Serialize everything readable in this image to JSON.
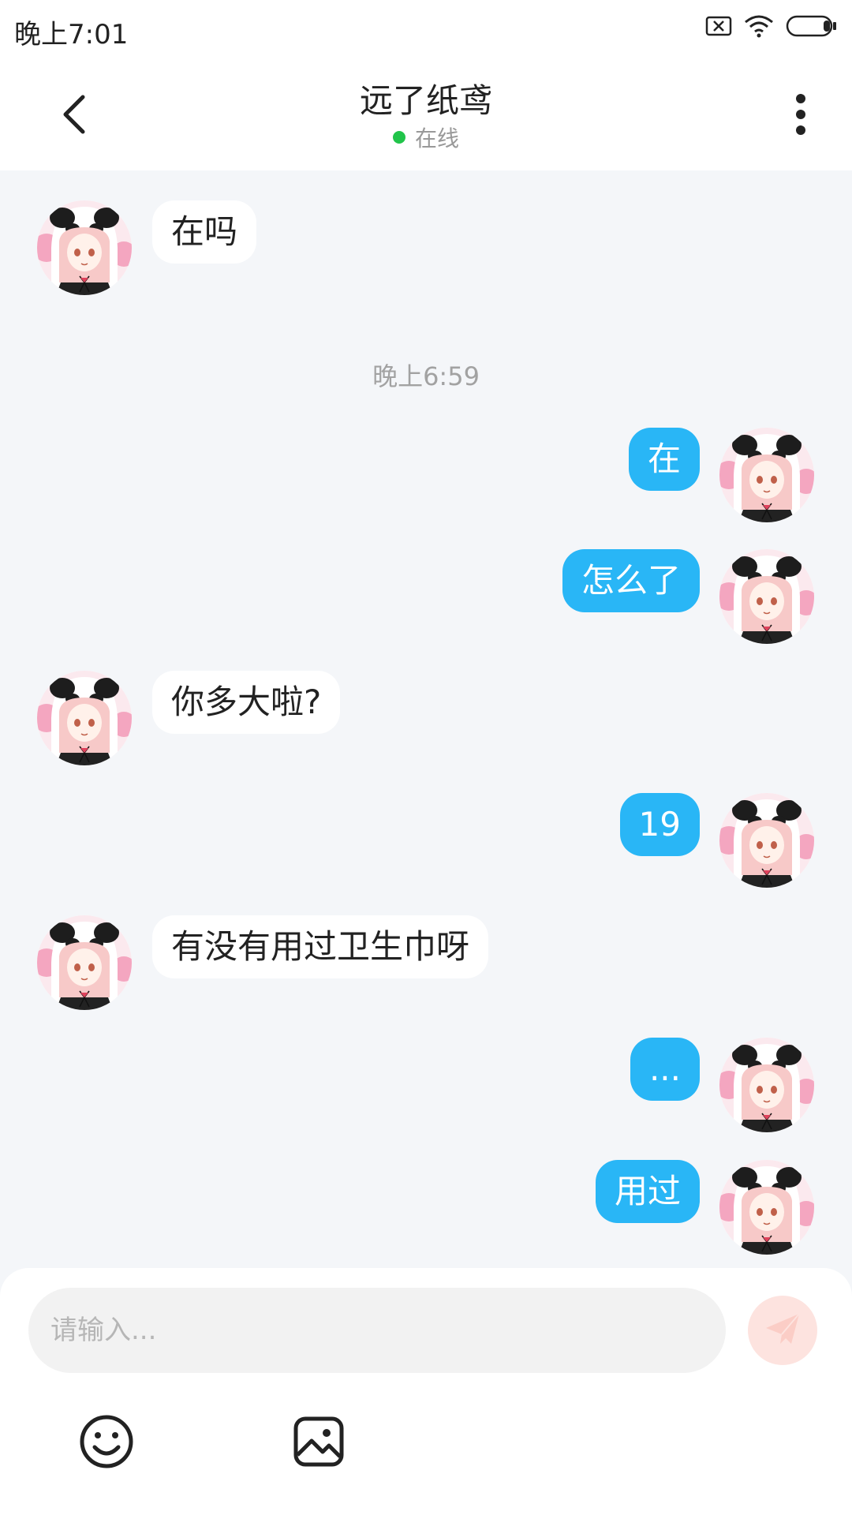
{
  "status_bar": {
    "time": "晚上7:01",
    "icons": [
      "sim-blocked-icon",
      "wifi-icon",
      "battery-icon"
    ]
  },
  "header": {
    "title": "远了纸鸢",
    "presence_text": "在线",
    "presence_color": "#21c44a",
    "back_icon": "chevron-left-icon",
    "more_icon": "more-vertical-icon"
  },
  "chat": {
    "timestamp": "晚上6:59",
    "messages": [
      {
        "direction": "incoming",
        "text": "在吗"
      },
      {
        "direction": "outgoing",
        "text": "在"
      },
      {
        "direction": "outgoing",
        "text": "怎么了"
      },
      {
        "direction": "incoming",
        "text": "你多大啦?"
      },
      {
        "direction": "outgoing",
        "text": "19"
      },
      {
        "direction": "incoming",
        "text": "有没有用过卫生巾呀"
      },
      {
        "direction": "outgoing",
        "text": "..."
      },
      {
        "direction": "outgoing",
        "text": "用过"
      }
    ]
  },
  "composer": {
    "placeholder": "请输入...",
    "value": "",
    "send_icon": "send-icon",
    "emoji_icon": "emoji-icon",
    "image_icon": "image-icon"
  },
  "colors": {
    "outgoing_bubble": "#29b6f6",
    "incoming_bubble": "#ffffff",
    "chat_background": "#f4f6f9",
    "send_button_disabled": "#fde3df"
  }
}
